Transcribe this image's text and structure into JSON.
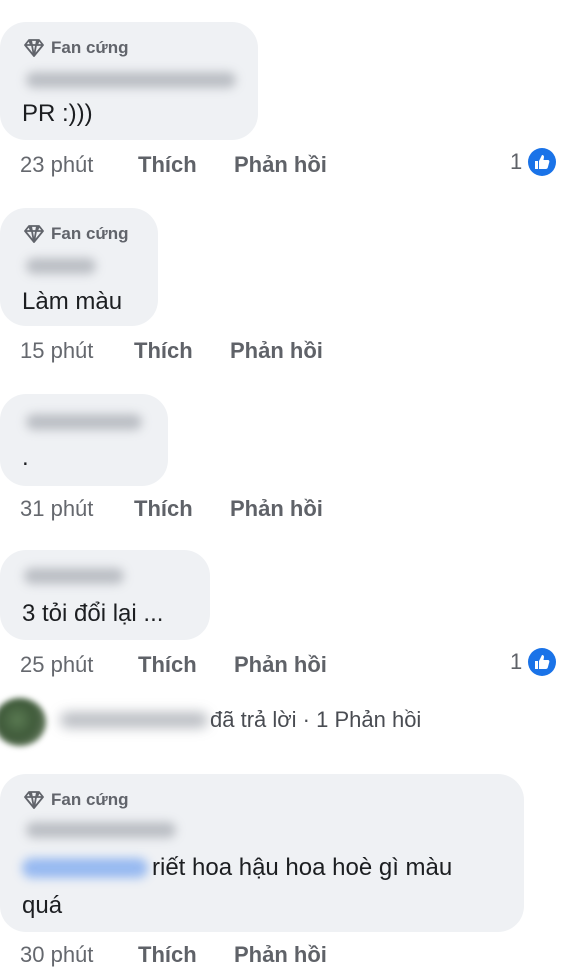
{
  "badge_label": "Fan cứng",
  "actions": {
    "like": "Thích",
    "reply": "Phản hồi"
  },
  "comments": [
    {
      "text": "PR :)))",
      "time": "23 phút",
      "like_count": "1"
    },
    {
      "text": "Làm màu",
      "time": "15 phút"
    },
    {
      "text": ".",
      "time": "31 phút"
    },
    {
      "text": "3 tỏi đổi lại ...",
      "time": "25 phút",
      "like_count": "1"
    },
    {
      "text_line1": "riết hoa hậu hoa hoè gì màu",
      "text_line2": "quá",
      "time": "30 phút"
    }
  ],
  "reply_summary": "đã trả lời · 1 Phản hồi",
  "colors": {
    "bubble": "#eff1f4",
    "like_blue": "#1a73e8",
    "meta_text": "#65686e"
  }
}
